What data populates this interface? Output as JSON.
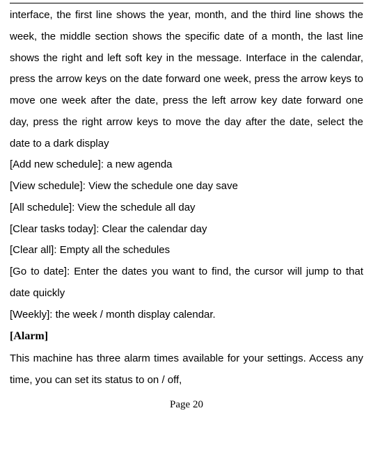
{
  "intro_paragraph": "interface, the first line shows the year, month, and the third line shows the week, the middle section shows the specific date of a month, the last line shows the right and left soft key in the message. Interface in the calendar, press the arrow keys on the date forward one week, press the arrow keys to move one week after the date, press the left arrow key date forward one day, press the right arrow keys to move the day after the date, select the date to a dark display",
  "items": [
    "[Add new schedule]: a new agenda",
    "[View schedule]: View the schedule one day save",
    "[All schedule]: View the schedule all day",
    "[Clear tasks today]: Clear the calendar day",
    "[Clear all]: Empty all the schedules",
    "[Go to date]: Enter the dates you want to find, the cursor will jump to that date quickly",
    "[Weekly]: the week / month display calendar."
  ],
  "alarm_heading": "[Alarm]",
  "alarm_body": "This machine has three alarm times available for your settings. Access any time, you can set its status to on / off,",
  "page_footer": "Page 20"
}
